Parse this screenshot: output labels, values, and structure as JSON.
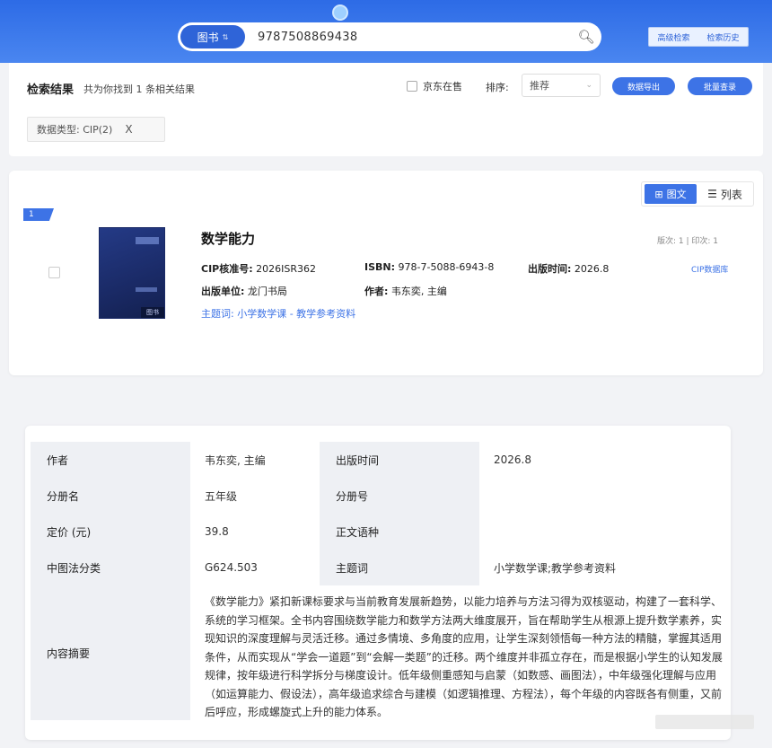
{
  "search": {
    "type_label": "图书",
    "query": "9787508869438",
    "links": [
      "高级检索",
      "检索历史"
    ]
  },
  "results": {
    "title": "检索结果",
    "summary": "共为你找到 1 条相关结果",
    "jd_label": "京东在售",
    "sort_label": "排序:",
    "sort_value": "推荐",
    "export_label": "数据导出",
    "batch_label": "批量查录",
    "filter_chip": "数据类型: CIP(2)",
    "filter_close": "X"
  },
  "item": {
    "index": "1",
    "view_tuwen": "图文",
    "view_list": "列表",
    "cover_tag": "图书",
    "title": "数学能力",
    "cip_label": "CIP核准号:",
    "cip_value": "2026ISR362",
    "isbn_label": "ISBN:",
    "isbn_value": "978-7-5088-6943-8",
    "pubtime_label": "出版时间:",
    "pubtime_value": "2026.8",
    "publisher_label": "出版单位:",
    "publisher_value": "龙门书局",
    "author_label": "作者:",
    "author_value": "韦东奕, 主编",
    "subject": "主题词: 小学数学课 - 教学参考资料",
    "edition": "版次: 1 | 印次: 1",
    "cip_db": "CIP数据库"
  },
  "detail": {
    "rows": [
      {
        "k1": "作者",
        "v1": "韦东奕, 主编",
        "k2": "出版时间",
        "v2": "2026.8"
      },
      {
        "k1": "分册名",
        "v1": "五年级",
        "k2": "分册号",
        "v2": ""
      },
      {
        "k1": "定价 (元)",
        "v1": "39.8",
        "k2": "正文语种",
        "v2": ""
      },
      {
        "k1": "中图法分类",
        "v1": "G624.503",
        "k2": "主题词",
        "v2": "小学数学课;教学参考资料"
      }
    ],
    "summary_label": "内容摘要",
    "summary_text": "《数学能力》紧扣新课标要求与当前教育发展新趋势，以能力培养与方法习得为双核驱动，构建了一套科学、系统的学习框架。全书内容围绕数学能力和数学方法两大维度展开，旨在帮助学生从根源上提升数学素养，实现知识的深度理解与灵活迁移。通过多情境、多角度的应用，让学生深刻领悟每一种方法的精髓，掌握其适用条件，从而实现从“学会一道题”到“会解一类题”的迁移。两个维度并非孤立存在，而是根据小学生的认知发展规律，按年级进行科学拆分与梯度设计。低年级侧重感知与启蒙（如数感、画图法），中年级强化理解与应用（如运算能力、假设法），高年级追求综合与建模（如逻辑推理、方程法），每个年级的内容既各有侧重，又前后呼应，形成螺旋式上升的能力体系。"
  }
}
